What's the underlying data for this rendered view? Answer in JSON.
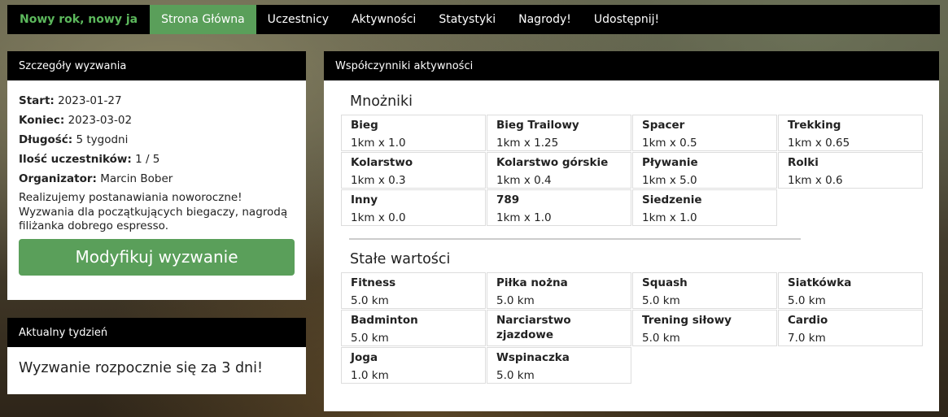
{
  "nav": {
    "brand": "Nowy rok, nowy ja",
    "items": [
      {
        "label": "Strona Główna",
        "active": true
      },
      {
        "label": "Uczestnicy",
        "active": false
      },
      {
        "label": "Aktywności",
        "active": false
      },
      {
        "label": "Statystyki",
        "active": false
      },
      {
        "label": "Nagrody!",
        "active": false
      },
      {
        "label": "Udostępnij!",
        "active": false
      }
    ]
  },
  "details": {
    "title": "Szczegóły wyzwania",
    "start_label": "Start:",
    "start_value": "2023-01-27",
    "end_label": "Koniec:",
    "end_value": "2023-03-02",
    "length_label": "Długość:",
    "length_value": "5 tygodni",
    "participants_label": "Ilość uczestników:",
    "participants_value": "1 / 5",
    "organizer_label": "Organizator:",
    "organizer_value": "Marcin Bober",
    "description": "Realizujemy postanawiania noworoczne! Wyzwania dla początkujących biegaczy, nagrodą filiżanka dobrego espresso.",
    "modify_button": "Modyfikuj wyzwanie"
  },
  "week": {
    "title": "Aktualny tydzień",
    "message": "Wyzwanie rozpocznie się za 3 dni!"
  },
  "coefficients": {
    "title": "Współczynniki aktywności",
    "multipliers_title": "Mnożniki",
    "multipliers": [
      {
        "name": "Bieg",
        "value": "1km x 1.0"
      },
      {
        "name": "Bieg Trailowy",
        "value": "1km x 1.25"
      },
      {
        "name": "Spacer",
        "value": "1km x 0.5"
      },
      {
        "name": "Trekking",
        "value": "1km x 0.65"
      },
      {
        "name": "Kolarstwo",
        "value": "1km x 0.3"
      },
      {
        "name": "Kolarstwo górskie",
        "value": "1km x 0.4"
      },
      {
        "name": "Pływanie",
        "value": "1km x 5.0"
      },
      {
        "name": "Rolki",
        "value": "1km x 0.6"
      },
      {
        "name": "Inny",
        "value": "1km x 0.0"
      },
      {
        "name": "789",
        "value": "1km x 1.0"
      },
      {
        "name": "Siedzenie",
        "value": "1km x 1.0"
      }
    ],
    "fixed_title": "Stałe wartości",
    "fixed": [
      {
        "name": "Fitness",
        "value": "5.0 km"
      },
      {
        "name": "Piłka nożna",
        "value": "5.0 km"
      },
      {
        "name": "Squash",
        "value": "5.0 km"
      },
      {
        "name": "Siatkówka",
        "value": "5.0 km"
      },
      {
        "name": "Badminton",
        "value": "5.0 km"
      },
      {
        "name": "Narciarstwo zjazdowe",
        "value": "5.0 km"
      },
      {
        "name": "Trening siłowy",
        "value": "5.0 km"
      },
      {
        "name": "Cardio",
        "value": "7.0 km"
      },
      {
        "name": "Joga",
        "value": "1.0 km"
      },
      {
        "name": "Wspinaczka",
        "value": "5.0 km"
      }
    ]
  },
  "colors": {
    "accent": "#5a9f5a",
    "brand": "#5cb85c",
    "header_bg": "#000000"
  }
}
